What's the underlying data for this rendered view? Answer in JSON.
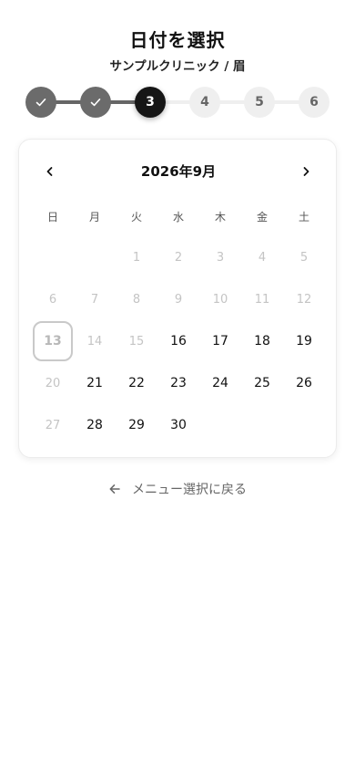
{
  "header": {
    "title": "日付を選択",
    "subtitle": "サンプルクリニック / 眉"
  },
  "stepper": {
    "steps": [
      "",
      "",
      "3",
      "4",
      "5",
      "6"
    ]
  },
  "calendar": {
    "month_label": "2026年9月",
    "prev_icon": "chevron-left-icon",
    "next_icon": "chevron-right-icon",
    "weekdays": [
      "日",
      "月",
      "火",
      "水",
      "木",
      "金",
      "土"
    ],
    "weeks": [
      [
        {
          "d": ""
        },
        {
          "d": ""
        },
        {
          "d": "1",
          "s": "disabled"
        },
        {
          "d": "2",
          "s": "disabled"
        },
        {
          "d": "3",
          "s": "disabled"
        },
        {
          "d": "4",
          "s": "disabled"
        },
        {
          "d": "5",
          "s": "disabled"
        }
      ],
      [
        {
          "d": "6",
          "s": "disabled"
        },
        {
          "d": "7",
          "s": "disabled"
        },
        {
          "d": "8",
          "s": "disabled"
        },
        {
          "d": "9",
          "s": "disabled"
        },
        {
          "d": "10",
          "s": "disabled"
        },
        {
          "d": "11",
          "s": "disabled"
        },
        {
          "d": "12",
          "s": "disabled"
        }
      ],
      [
        {
          "d": "13",
          "s": "today"
        },
        {
          "d": "14",
          "s": "disabled"
        },
        {
          "d": "15",
          "s": "disabled"
        },
        {
          "d": "16",
          "s": "enabled"
        },
        {
          "d": "17",
          "s": "enabled"
        },
        {
          "d": "18",
          "s": "enabled"
        },
        {
          "d": "19",
          "s": "enabled"
        }
      ],
      [
        {
          "d": "20",
          "s": "disabled"
        },
        {
          "d": "21",
          "s": "enabled"
        },
        {
          "d": "22",
          "s": "enabled"
        },
        {
          "d": "23",
          "s": "enabled"
        },
        {
          "d": "24",
          "s": "enabled"
        },
        {
          "d": "25",
          "s": "enabled"
        },
        {
          "d": "26",
          "s": "enabled"
        }
      ],
      [
        {
          "d": "27",
          "s": "disabled"
        },
        {
          "d": "28",
          "s": "enabled"
        },
        {
          "d": "29",
          "s": "enabled"
        },
        {
          "d": "30",
          "s": "enabled"
        },
        {
          "d": ""
        },
        {
          "d": ""
        },
        {
          "d": ""
        }
      ]
    ]
  },
  "footer": {
    "back_label": "メニュー選択に戻る",
    "back_icon": "arrow-left-icon"
  },
  "colors": {
    "done_step": "#6b6b6b",
    "active_step": "#161616",
    "todo_step": "#efefef",
    "disabled_text": "#c4c4c4"
  }
}
